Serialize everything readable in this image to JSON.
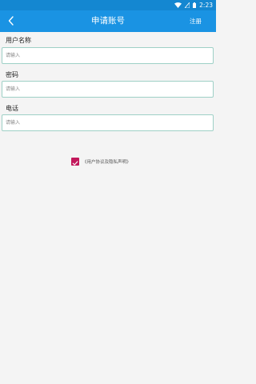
{
  "status_bar": {
    "time": "2:23",
    "icons": [
      "wifi-icon",
      "signal-icon",
      "battery-icon"
    ]
  },
  "header": {
    "title": "申请账号",
    "back_icon": "chevron-left-icon",
    "action_label": "注册"
  },
  "form": {
    "fields": [
      {
        "label": "用户名称",
        "placeholder": "请输入",
        "value": ""
      },
      {
        "label": "密码",
        "placeholder": "请输入",
        "value": ""
      },
      {
        "label": "电话",
        "placeholder": "请输入",
        "value": ""
      }
    ]
  },
  "agreement": {
    "checked": true,
    "link_text": "《用户协议及隐私声明》"
  },
  "colors": {
    "app_bar": "#1a93e3",
    "status_bar": "#1487d1",
    "input_border": "#9ed0c6",
    "checkbox": "#c2185b",
    "background": "#f4f4f4"
  }
}
